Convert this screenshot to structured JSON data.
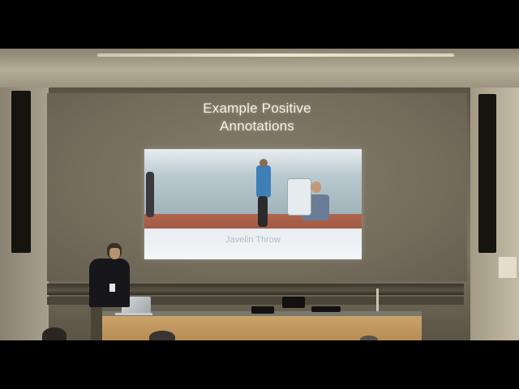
{
  "slide": {
    "title_line1": "Example Positive",
    "title_line2": "Annotations",
    "image_caption": "Javelin Throw"
  }
}
